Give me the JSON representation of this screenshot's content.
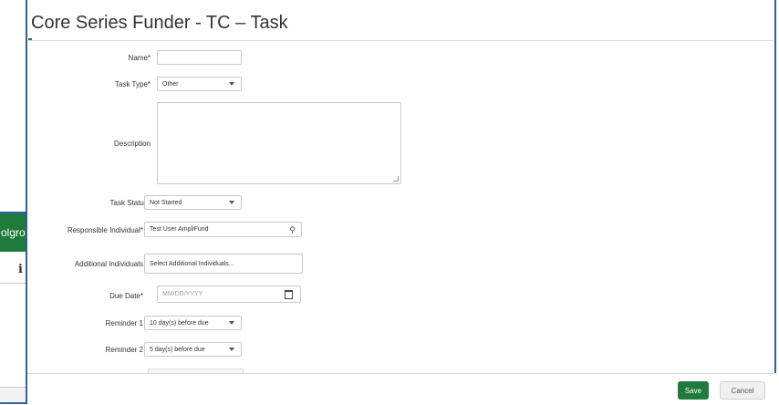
{
  "background_window": {
    "user_menu_label": "olgrove",
    "toolbar_icons": [
      "info-icon",
      "plus-icon",
      "export-icon"
    ]
  },
  "dialog": {
    "title": "Core Series Funder - TC – Task",
    "fields": {
      "name": {
        "label": "Name*",
        "value": ""
      },
      "task_type": {
        "label": "Task Type*",
        "value": "Other"
      },
      "description": {
        "label": "Description",
        "value": ""
      },
      "task_status": {
        "label": "Task Status*",
        "value": "Not Started"
      },
      "responsible": {
        "label": "Responsible Individual*",
        "value": "Test User AmpliFund"
      },
      "additional": {
        "label": "Additional Individuals",
        "placeholder": "Select Additional Individuals..."
      },
      "due_date": {
        "label": "Due Date*",
        "placeholder": "MM/DD/YYYY"
      },
      "reminder1": {
        "label": "Reminder 1",
        "value": "10 day(s) before due"
      },
      "reminder2": {
        "label": "Reminder 2",
        "value": "5 day(s) before due"
      }
    },
    "buttons": {
      "save": "Save",
      "cancel": "Cancel"
    },
    "colors": {
      "accent": "#1f7a3b",
      "border": "#2f5f9e"
    }
  }
}
